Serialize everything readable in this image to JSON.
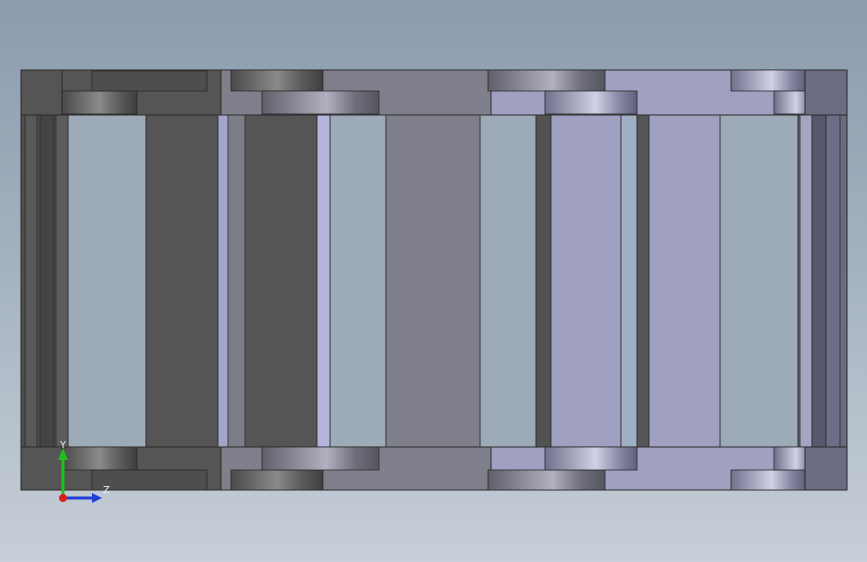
{
  "viewport": {
    "background_top": "#8a9cad",
    "background_bottom": "#c7cfd8"
  },
  "model": {
    "description_icon": "cable-drag-chain-3d-model",
    "colors": {
      "dark_link": "#555555",
      "mid_link": "#7c7c86",
      "light_link": "#9fa0c0",
      "edge": "#2a2a2a"
    }
  },
  "triad": {
    "y_label": "Y",
    "z_label": "Z",
    "y_color": "#1fbf1f",
    "z_color": "#1f3fd8",
    "x_color": "#d81f1f"
  }
}
